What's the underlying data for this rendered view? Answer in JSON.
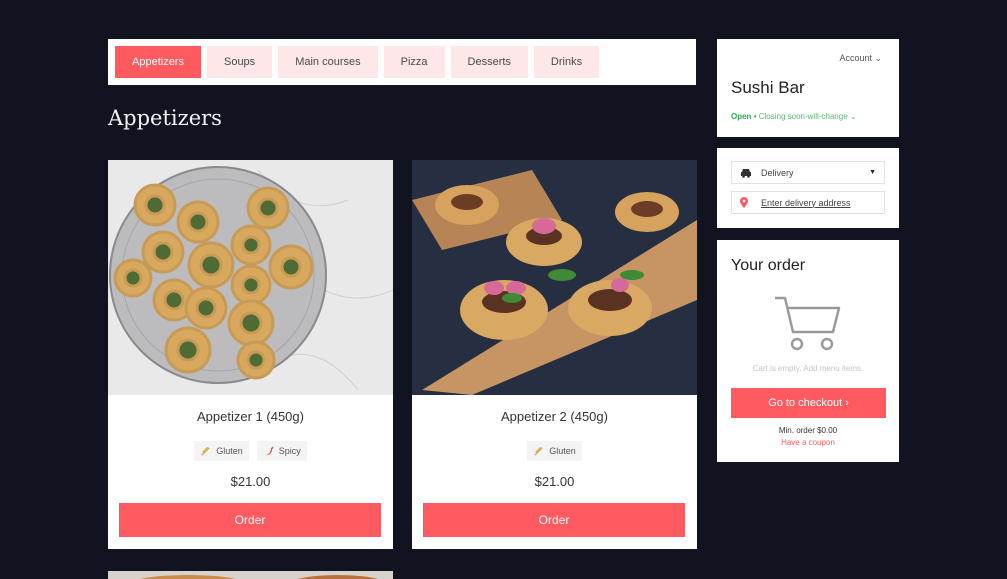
{
  "tabs": [
    {
      "label": "Appetizers",
      "active": true
    },
    {
      "label": "Soups"
    },
    {
      "label": "Main courses"
    },
    {
      "label": "Pizza"
    },
    {
      "label": "Desserts"
    },
    {
      "label": "Drinks"
    }
  ],
  "section": {
    "title": "Appetizers"
  },
  "products": [
    {
      "name": "Appetizer 1 (450g)",
      "tags": [
        {
          "label": "Gluten",
          "icon": "wheat-icon"
        },
        {
          "label": "Spicy",
          "icon": "chili-icon"
        }
      ],
      "price": "$21.00",
      "order_label": "Order"
    },
    {
      "name": "Appetizer 2 (450g)",
      "tags": [
        {
          "label": "Gluten",
          "icon": "wheat-icon"
        }
      ],
      "price": "$21.00",
      "order_label": "Order"
    }
  ],
  "store": {
    "account_label": "Account ⌄",
    "name": "Sushi Bar",
    "status": "Open",
    "closing_text": "Closing soon-will-change ⌄"
  },
  "delivery": {
    "selected_option": "Delivery",
    "address_placeholder": "Enter delivery address"
  },
  "order": {
    "title": "Your order",
    "empty_text": "Cart is empty. Add menu items.",
    "checkout_label": "Go to checkout ›",
    "min_order": "Min. order $0.00",
    "coupon_link": "Have a coupon"
  },
  "colors": {
    "background": "#121320",
    "accent": "#ff5a5f",
    "tab_bg": "#fde7e9",
    "open_green": "#2fa84f"
  }
}
